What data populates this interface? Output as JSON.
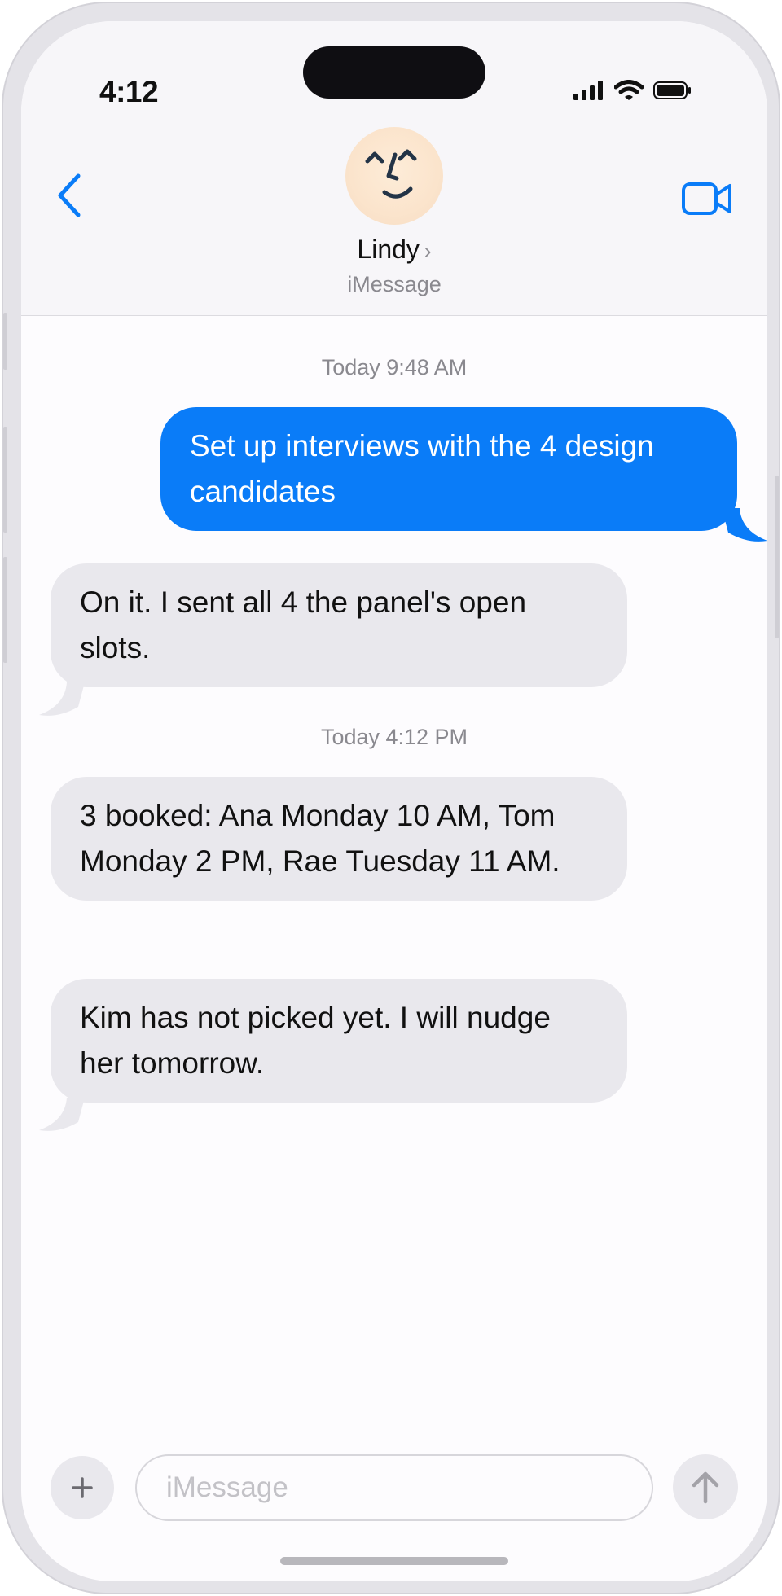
{
  "status_bar": {
    "time": "4:12"
  },
  "header": {
    "contact_name": "Lindy",
    "contact_chevron": "›",
    "service": "iMessage",
    "icons": {
      "back": "chevron-left-icon",
      "video": "video-camera-icon",
      "avatar": "smiley-face-avatar"
    },
    "accent_color": "#0A7CF8"
  },
  "messages": [
    {
      "type": "timestamp",
      "text": "Today 9:48 AM"
    },
    {
      "type": "outgoing",
      "text": "Set up interviews with the 4 design candidates"
    },
    {
      "type": "incoming",
      "text": "On it. I sent all 4 the panel's open slots."
    },
    {
      "type": "timestamp",
      "text": "Today 4:12 PM"
    },
    {
      "type": "incoming",
      "text": "3 booked: Ana Monday 10 AM, Tom Monday 2 PM, Rae Tuesday 11 AM."
    },
    {
      "type": "incoming",
      "text": "Kim has not picked yet. I will nudge her tomorrow."
    }
  ],
  "composer": {
    "placeholder": "iMessage",
    "value": "",
    "icons": {
      "plus": "plus-icon",
      "send": "arrow-up-icon"
    }
  },
  "colors": {
    "outgoing_bubble": "#0A7CF8",
    "incoming_bubble": "#E9E8ED"
  }
}
